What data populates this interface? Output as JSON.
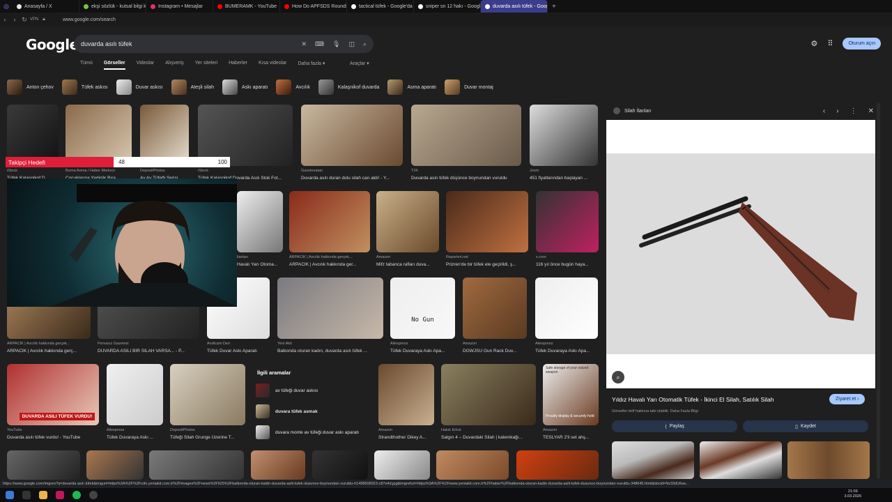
{
  "browser": {
    "tabs": [
      {
        "label": "Anasayfa / X",
        "color": "#e6e6e6"
      },
      {
        "label": "ekşi sözlük - kutsal bilgi k",
        "color": "#7cc242"
      },
      {
        "label": "Instagram • Mesajlar",
        "color": "#e1306c"
      },
      {
        "label": "BUMERAMK - YouTube",
        "color": "#ff0000"
      },
      {
        "label": "How Do APFSDS Rounds",
        "color": "#ff0000"
      },
      {
        "label": "tactical tüfek - Google'da",
        "color": "#ffffff"
      },
      {
        "label": "sniper sn 12 hakı - Google",
        "color": "#ffffff"
      },
      {
        "label": "duvarda asılı tüfek - Goog",
        "color": "#ffffff",
        "active": true
      }
    ],
    "url": "www.google.com/search",
    "status_url": "https://www.google.com/imgres?q=duvarda asılı tüfek&imgurl=https%3A%2F%2Fcdn.yeniakit.com.tr%2Fimages%2Fnews%2F625%2Fbalkonda-oturan-kadin-duvarda-asili-tufek-dusunce-boynundan-vuruldu-h1498508923-c87e4d.jpg&imgrefurl=https%3A%2F%2Fwww.yeniakit.com.tr%2Fhaber%2Fbalkonda-oturan-kadin-duvarda-asili-tufek-dusunce-boynundan-vuruldu-348645.html&docid=Nz33dUfuw..."
  },
  "google": {
    "logo": "Google",
    "query": "duvarda asılı tüfek",
    "signin": "Oturum açın",
    "nav": [
      "Tümü",
      "Görseller",
      "Videolar",
      "Alışveriş",
      "Yer siteleri",
      "Haberler",
      "Kısa videolar",
      "Daha fazla ▾"
    ],
    "selected_nav": "Görseller",
    "tools": "Araçlar ▾"
  },
  "chips": [
    "Anton çehov",
    "Tüfek askısı",
    "Duvar askısı",
    "Ateşli silah",
    "Askı aparatı",
    "Avcılık",
    "Kalaşnikof duvarda",
    "Asma aparatı",
    "Duvar montaj"
  ],
  "results": [
    {
      "src": "iStock",
      "cap": "Tüfek Kalaşnikof D..."
    },
    {
      "src": "Burna Arena / Haber Merkezi",
      "cap": "Çocuklarına Yadigâr Bıra..."
    },
    {
      "src": "DepositPhotos",
      "cap": "Av Av Tüfeği Serisi..."
    },
    {
      "src": "iStock",
      "cap": "Tüfek Kalaşnikof Duvarda Asılı Stok Fot..."
    },
    {
      "src": "Gazetevatan",
      "cap": "Duvarda asılı duran dolu silah can aldı! - Y..."
    },
    {
      "src": "T24",
      "cap": "Duvarda asılı tüfek düşünce boynundan vuruldu"
    },
    {
      "src": "Joom",
      "cap": "451 fiyatlarından başlayan ..."
    },
    {
      "src": "ilanları",
      "cap": "Havalı Yarı Otoma..."
    },
    {
      "src": "ARPACIK | Avcılık hakkında gerçek...",
      "cap": "ARPACIK | Avcılık hakkında ger..."
    },
    {
      "src": "Amazon",
      "cap": "Mifz tabanca rafları duva..."
    },
    {
      "src": "Reporteri.net",
      "cap": "Prizren'de bir tüfek ele geçirildi, ş..."
    },
    {
      "src": "x.com",
      "cap": "116 yıl önce bugün haya..."
    },
    {
      "src": "ARPACIK | Avcılık hakkında gerçek...",
      "cap": "ARPACIK | Avcılık hakkında gerç..."
    },
    {
      "src": "Pervasız Gazetesi",
      "cap": "DUVARDA ASILI BİR SİLAH VARSA... - P..."
    },
    {
      "src": "Andicam Deri",
      "cap": "Tüfek Duvar Askı Aparatı"
    },
    {
      "src": "Yeni Akit",
      "cap": "Balkonda oturan kadın, duvarda asılı tüfek ..."
    },
    {
      "src": "Aliexpress",
      "cap": "Tüfek Duvaraya Askı Apa..."
    },
    {
      "src": "Amazon",
      "cap": "DGWJSU Gun Rack Duv..."
    },
    {
      "src": "Aliexpress",
      "cap": "Tüfek Duvaraya Askı Apa..."
    },
    {
      "src": "YouTube",
      "cap": "Duvarda asılı tüfek vurdu! - YouTube"
    },
    {
      "src": "Aliexpress",
      "cap": "Tüfek Duvaraya Askı ..."
    },
    {
      "src": "DepositPhotos",
      "cap": "Tüfeği Silah Grunge Üzerine T..."
    },
    {
      "src": "Amazon",
      "cap": "Strandthother Dikey A..."
    },
    {
      "src": "Haluk Erkut",
      "cap": "Salgın 4 – Duvardaki Silah | kalemkağı..."
    },
    {
      "src": "Amazon",
      "cap": "TESLYAR 2'li set ahş..."
    }
  ],
  "image_texts": {
    "no_gun": "No Gun",
    "youtube_banner": "DUVARDA ASILI TÜFEK VURDU!",
    "safe_storage": "Safe storage of your valued weapon",
    "proudly": "Proudly display & securely hold"
  },
  "related": {
    "title": "İlgili aramalar",
    "items": [
      "av tüfeği duvar askısı",
      "duvara tüfek asmak",
      "duvara monte av tüfeği duvar askı aparatı"
    ]
  },
  "panel": {
    "source": "Silah İlanları",
    "title": "Yıldız Havalı Yarı Otomatik Tüfek - İkinci El Silah, Satılık Silah",
    "visit": "Ziyaret et ›",
    "note": "Görseller telif hakkına tabi olabilir. Daha Fazla Bilgi",
    "share": "Paylaş",
    "save": "Kaydet"
  },
  "tracker": {
    "label": "Takipçi Hedefi",
    "current": "48",
    "max": "100",
    "progress": 0.48,
    "color": "#e01e3a"
  },
  "clock": {
    "time": "21:09",
    "date": "3.03.2026"
  }
}
